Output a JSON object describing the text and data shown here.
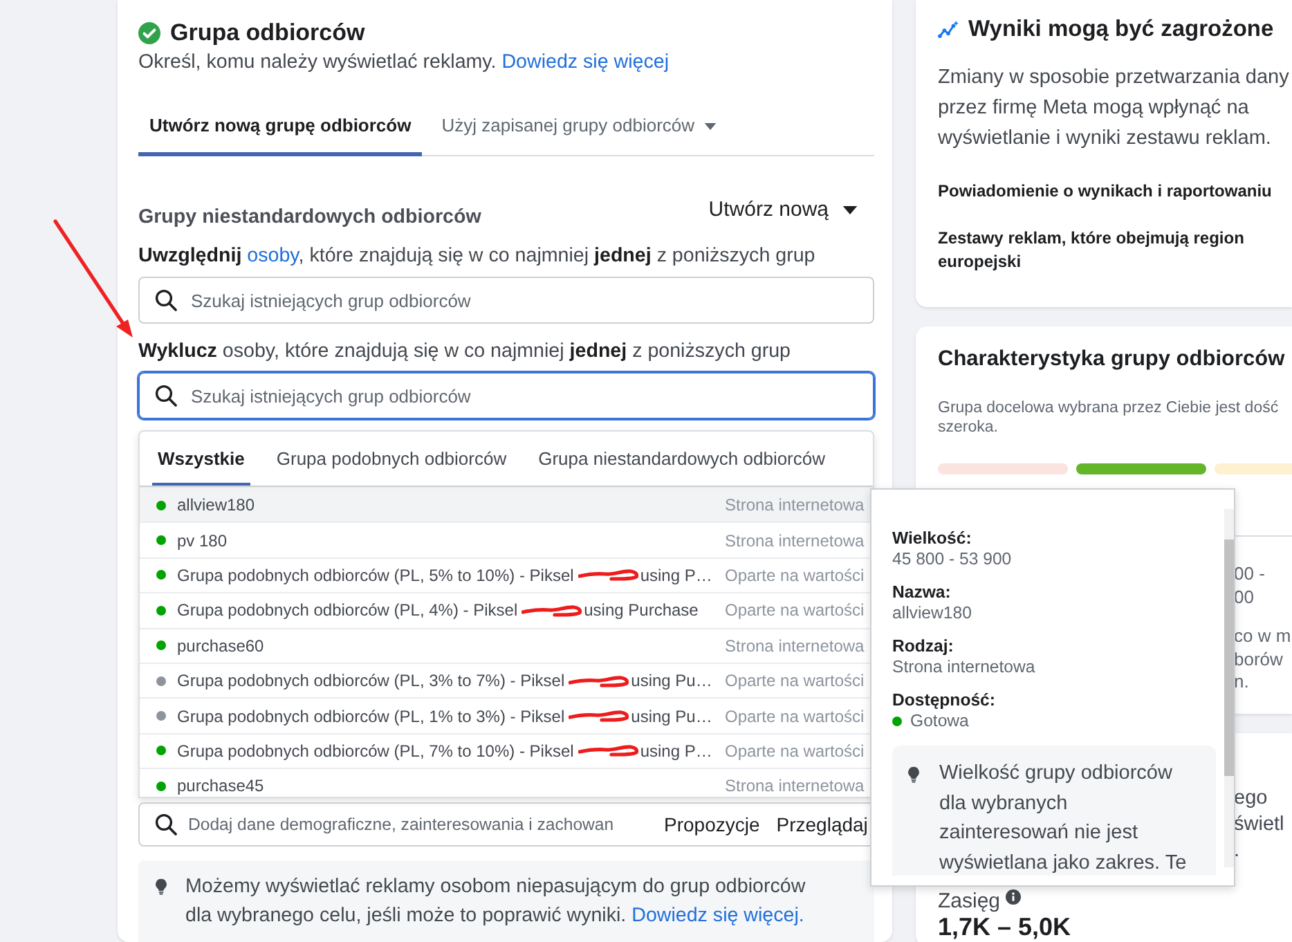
{
  "audience_card": {
    "title": "Grupa odbiorców",
    "complete": true,
    "subtitle": "Określ, komu należy wyświetlać reklamy.",
    "subtitle_link": "Dowiedz się więcej",
    "tabs": [
      {
        "label": "Utwórz nową grupę odbiorców",
        "selected": true,
        "has_menu": false
      },
      {
        "label": "Użyj zapisanej grupy odbiorców",
        "selected": false,
        "has_menu": true
      }
    ]
  },
  "custom_audiences": {
    "heading": "Grupy niestandardowych odbiorców",
    "create_button": "Utwórz nową",
    "include": {
      "before": "**Uwzględnij** ",
      "link": "osoby",
      "after": ", które znajdują się w co najmniej **jednej** z poniższych grup",
      "placeholder": "Szukaj istniejących grup odbiorców",
      "focused": false
    },
    "exclude": {
      "text": "**Wyklucz** osoby, które znajdują się w co najmniej **jednej** z poniższych grup",
      "placeholder": "Szukaj istniejących grup odbiorców",
      "focused": true
    }
  },
  "audience_dropdown": {
    "tabs": [
      {
        "label": "Wszystkie",
        "selected": true
      },
      {
        "label": "Grupa podobnych odbiorców",
        "selected": false
      },
      {
        "label": "Grupa niestandardowych odbiorców",
        "selected": false
      }
    ],
    "rows": [
      {
        "name": "allview180",
        "redacted": false,
        "type": "Strona internetowa",
        "color": "#00a400",
        "selected": true
      },
      {
        "name": "pv 180",
        "redacted": false,
        "type": "Strona internetowa",
        "color": "#00a400",
        "selected": false
      },
      {
        "name": "Grupa podobnych odbiorców (PL, 5% to 10%) - Piksel",
        "redacted": true,
        "name_end": "using P…",
        "type": "Oparte na wartości",
        "color": "#00a400",
        "selected": false
      },
      {
        "name": "Grupa podobnych odbiorców (PL, 4%) - Piksel",
        "redacted": true,
        "name_end": "using Purchase",
        "type": "Oparte na wartości",
        "color": "#00a400",
        "selected": false
      },
      {
        "name": "purchase60",
        "redacted": false,
        "type": "Strona internetowa",
        "color": "#00a400",
        "selected": false
      },
      {
        "name": "Grupa podobnych odbiorców (PL, 3% to 7%) - Piksel",
        "redacted": true,
        "name_end": "using Pu…",
        "type": "Oparte na wartości",
        "color": "#8d949e",
        "selected": false
      },
      {
        "name": "Grupa podobnych odbiorców (PL, 1% to 3%) - Piksel",
        "redacted": true,
        "name_end": "using Pu…",
        "type": "Oparte na wartości",
        "color": "#8d949e",
        "selected": false
      },
      {
        "name": "Grupa podobnych odbiorców (PL, 7% to 10%) - Piksel",
        "redacted": true,
        "name_end": "using P…",
        "type": "Oparte na wartości",
        "color": "#00a400",
        "selected": false
      },
      {
        "name": "purchase45",
        "redacted": false,
        "type": "Strona internetowa",
        "color": "#00a400",
        "selected": false
      }
    ]
  },
  "audience_tooltip": {
    "fields": [
      {
        "kind": "text",
        "label": "Wielkość:",
        "value": "45 800 - 53 900"
      },
      {
        "kind": "text",
        "label": "Nazwa:",
        "value": "allview180"
      },
      {
        "kind": "text",
        "label": "Rodzaj:",
        "value": "Strona internetowa"
      },
      {
        "kind": "status",
        "label": "Dostępność:",
        "value": "Gotowa",
        "color": "#00a400"
      }
    ],
    "note": "Wielkość grupy odbiorców dla wybranych zainteresowań nie jest wyświetlana jako zakres. Te"
  },
  "detailed_targeting": {
    "placeholder": "Dodaj dane demograficzne, zainteresowania i zachowan",
    "buttons": [
      "Propozycje",
      "Przeglądaj"
    ]
  },
  "notice": {
    "text": "Możemy wyświetlać reklamy osobom niepasującym do grup odbiorców dla wybranego celu, jeśli może to poprawić wyniki.",
    "link": "Dowiedz się więcej."
  },
  "results_warning": {
    "title": "Wyniki mogą być zagrożone",
    "body": "Zmiany w sposobie przetwarzania dany przez firmę Meta mogą wpłynąć na wyświetlanie i wyniki zestawu reklam.",
    "items": [
      "Powiadomienie o wynikach i raportowaniu",
      "Zestawy reklam, które obejmują region europejski"
    ]
  },
  "audience_definition": {
    "title": "Charakterystyka grupy odbiorców",
    "description": "Grupa docelowa wybrana przez Ciebie jest dość szeroka.",
    "meter": [
      {
        "color": "#fbe3df"
      },
      {
        "color": "#63b52a"
      },
      {
        "color": "#fdf1d2"
      }
    ],
    "fragments": [
      {
        "lines": [
          "00 -",
          "00"
        ]
      },
      {
        "lines": [
          "co w m",
          "borów",
          "n."
        ]
      }
    ]
  },
  "estimated_results": {
    "fragments": [
      "ego",
      "świetl",
      "."
    ],
    "reach_label": "Zasięg",
    "reach_value": "1,7K – 5,0K"
  }
}
